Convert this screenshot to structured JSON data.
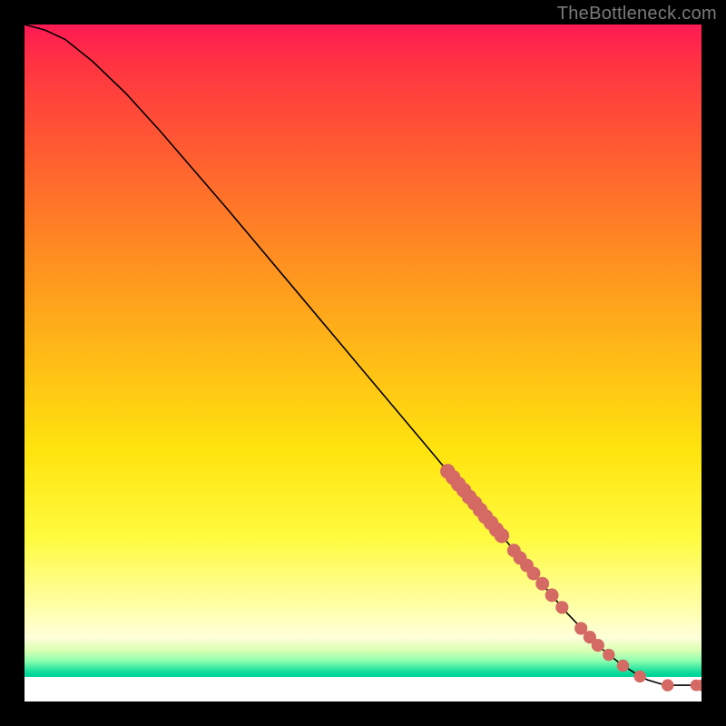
{
  "attribution": "TheBottleneck.com",
  "colors": {
    "dot_fill": "#d46a63",
    "curve_stroke": "#000000"
  },
  "chart_data": {
    "type": "line",
    "title": "",
    "xlabel": "",
    "ylabel": "",
    "xlim": [
      0,
      100
    ],
    "ylim": [
      0,
      100
    ],
    "curve": [
      {
        "x": 0.0,
        "y": 100.0
      },
      {
        "x": 3.0,
        "y": 99.2
      },
      {
        "x": 6.0,
        "y": 97.8
      },
      {
        "x": 10.0,
        "y": 94.6
      },
      {
        "x": 15.0,
        "y": 89.8
      },
      {
        "x": 20.0,
        "y": 84.3
      },
      {
        "x": 30.0,
        "y": 72.7
      },
      {
        "x": 40.0,
        "y": 60.8
      },
      {
        "x": 50.0,
        "y": 48.9
      },
      {
        "x": 60.0,
        "y": 37.0
      },
      {
        "x": 65.0,
        "y": 31.0
      },
      {
        "x": 70.0,
        "y": 25.1
      },
      {
        "x": 75.0,
        "y": 19.1
      },
      {
        "x": 80.0,
        "y": 13.2
      },
      {
        "x": 85.0,
        "y": 8.0
      },
      {
        "x": 88.0,
        "y": 5.6
      },
      {
        "x": 90.0,
        "y": 4.3
      },
      {
        "x": 92.0,
        "y": 3.2
      },
      {
        "x": 94.0,
        "y": 2.6
      },
      {
        "x": 95.0,
        "y": 2.4
      },
      {
        "x": 99.0,
        "y": 2.4
      },
      {
        "x": 100.0,
        "y": 2.4
      }
    ],
    "points": [
      {
        "x": 62.5,
        "y": 34.0,
        "r": 1.1
      },
      {
        "x": 63.3,
        "y": 33.1,
        "r": 1.1
      },
      {
        "x": 64.1,
        "y": 32.1,
        "r": 1.1
      },
      {
        "x": 64.9,
        "y": 31.2,
        "r": 1.1
      },
      {
        "x": 65.7,
        "y": 30.2,
        "r": 1.1
      },
      {
        "x": 66.5,
        "y": 29.3,
        "r": 1.1
      },
      {
        "x": 67.3,
        "y": 28.3,
        "r": 1.1
      },
      {
        "x": 68.1,
        "y": 27.3,
        "r": 1.1
      },
      {
        "x": 68.9,
        "y": 26.4,
        "r": 1.1
      },
      {
        "x": 69.7,
        "y": 25.4,
        "r": 1.1
      },
      {
        "x": 70.5,
        "y": 24.5,
        "r": 1.1
      },
      {
        "x": 72.3,
        "y": 22.3,
        "r": 1.0
      },
      {
        "x": 73.2,
        "y": 21.2,
        "r": 1.0
      },
      {
        "x": 74.2,
        "y": 20.1,
        "r": 1.0
      },
      {
        "x": 75.2,
        "y": 18.9,
        "r": 1.0
      },
      {
        "x": 76.5,
        "y": 17.4,
        "r": 1.0
      },
      {
        "x": 77.9,
        "y": 15.7,
        "r": 1.0
      },
      {
        "x": 79.4,
        "y": 13.9,
        "r": 0.95
      },
      {
        "x": 82.2,
        "y": 10.8,
        "r": 0.95
      },
      {
        "x": 83.5,
        "y": 9.5,
        "r": 0.95
      },
      {
        "x": 84.7,
        "y": 8.3,
        "r": 0.95
      },
      {
        "x": 86.3,
        "y": 6.9,
        "r": 0.9
      },
      {
        "x": 88.4,
        "y": 5.3,
        "r": 0.9
      },
      {
        "x": 90.9,
        "y": 3.7,
        "r": 0.9
      },
      {
        "x": 95.0,
        "y": 2.4,
        "r": 0.9
      },
      {
        "x": 99.2,
        "y": 2.4,
        "r": 0.85
      },
      {
        "x": 100.0,
        "y": 2.4,
        "r": 0.85
      }
    ]
  }
}
